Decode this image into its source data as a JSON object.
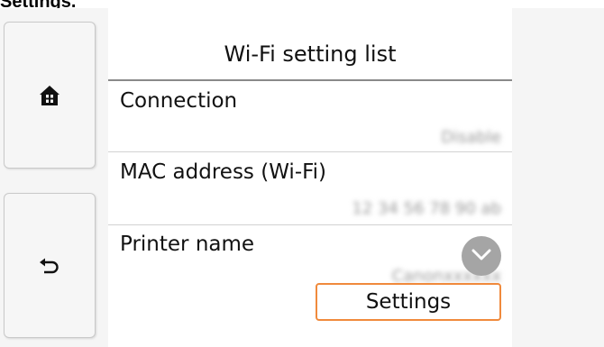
{
  "page_heading": "Settings.",
  "nav": {
    "home_icon": "home-icon",
    "back_icon": "back-arrow-icon"
  },
  "panel": {
    "title": "Wi-Fi setting list",
    "rows": [
      {
        "label": "Connection",
        "value": "Disable"
      },
      {
        "label": "MAC address (Wi-Fi)",
        "value": "12 34 56 78 90 ab"
      },
      {
        "label": "Printer name",
        "value": "Canonxxxxxx"
      }
    ],
    "dropdown_icon": "chevron-down-icon",
    "settings_label": "Settings"
  },
  "colors": {
    "accent_border": "#f08a3c",
    "background": "#f5f5f5",
    "panel": "#ffffff"
  }
}
